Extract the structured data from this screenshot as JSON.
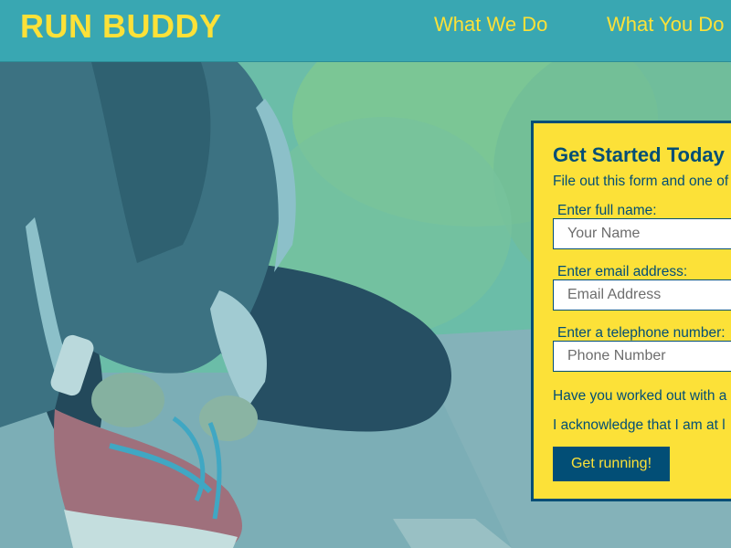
{
  "header": {
    "logo": "RUN BUDDY",
    "nav": [
      {
        "label": "What We Do"
      },
      {
        "label": "What You Do"
      }
    ]
  },
  "hero": {
    "image": "runner-tying-shoe-photo"
  },
  "form": {
    "title": "Get Started Today",
    "subtitle": "File out this form and one of",
    "fields": [
      {
        "label": "Enter full name:",
        "placeholder": "Your Name",
        "value": ""
      },
      {
        "label": "Enter email address:",
        "placeholder": "Email Address",
        "value": ""
      },
      {
        "label": "Enter a telephone number:",
        "placeholder": "Phone Number",
        "value": ""
      }
    ],
    "question_workout": "Have you worked out with a",
    "acknowledge": "I acknowledge that I am at l",
    "submit_label": "Get running!"
  },
  "colors": {
    "header_bg": "#39a7b2",
    "accent_yellow": "#fce138",
    "dark_blue": "#024e76"
  }
}
